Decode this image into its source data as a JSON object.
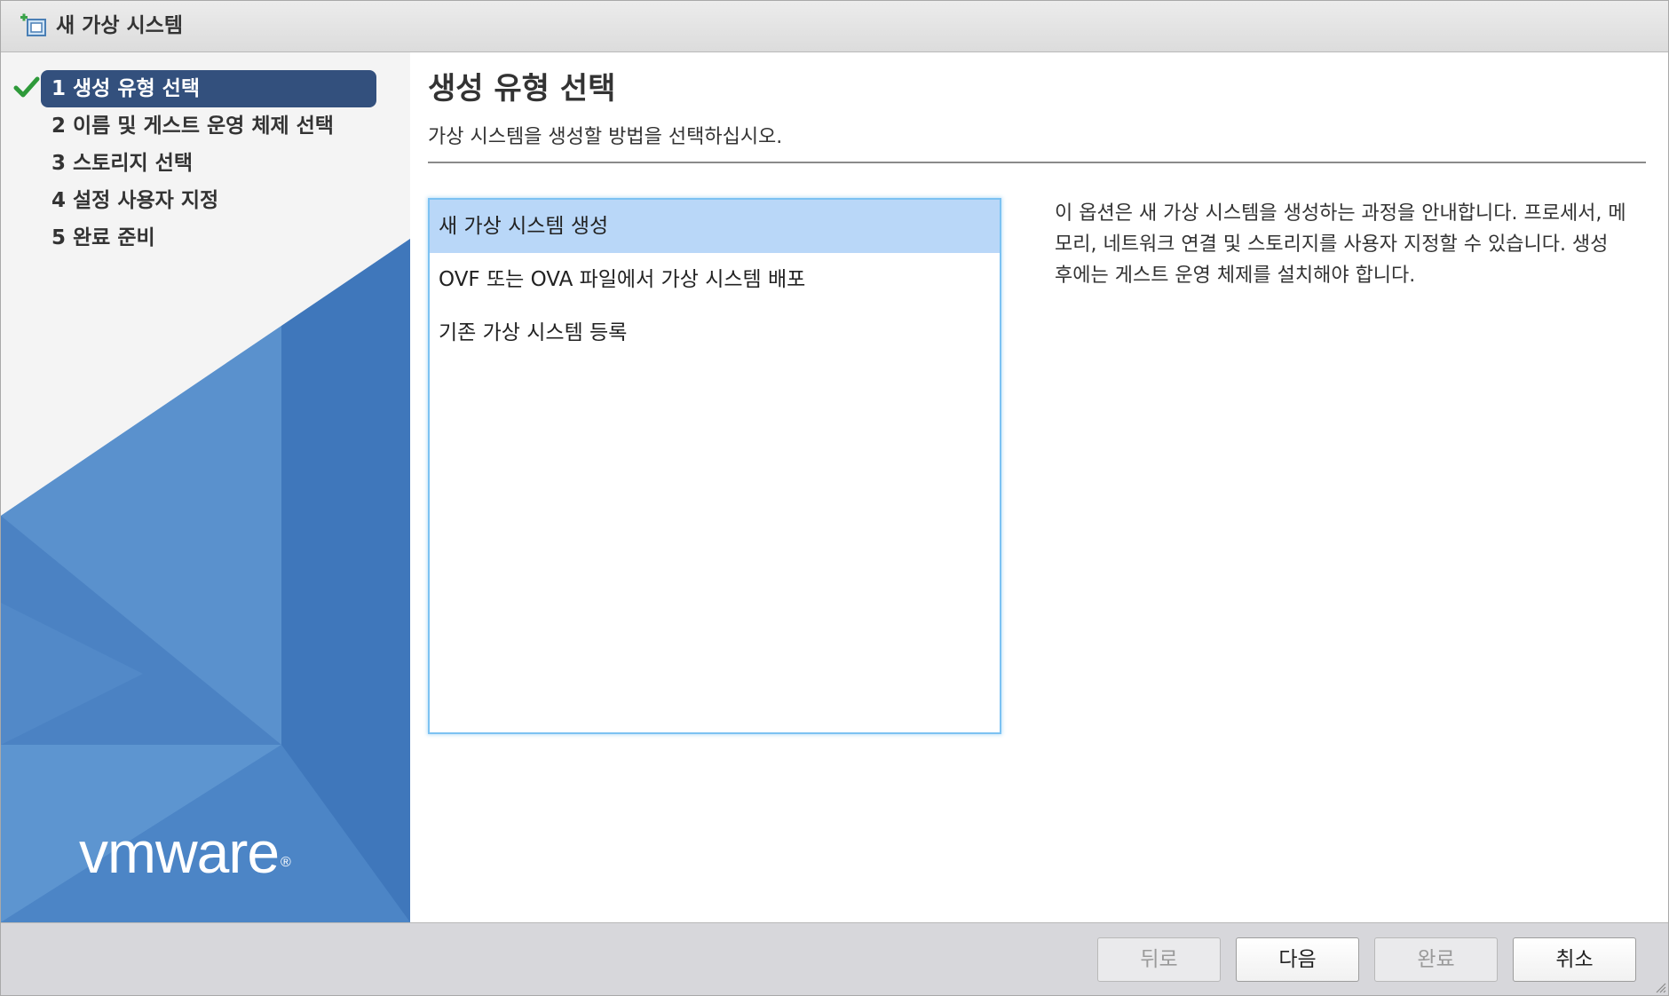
{
  "window": {
    "title": "새 가상 시스템",
    "icon": "new-vm-icon"
  },
  "steps": [
    {
      "label": "1 생성 유형 선택",
      "state": "active",
      "completed": true
    },
    {
      "label": "2 이름 및 게스트 운영 체제 선택",
      "state": "pending"
    },
    {
      "label": "3 스토리지 선택",
      "state": "pending"
    },
    {
      "label": "4 설정 사용자 지정",
      "state": "pending"
    },
    {
      "label": "5 완료 준비",
      "state": "pending"
    }
  ],
  "brand": {
    "logo_text": "vmware",
    "registered_mark": "®"
  },
  "main": {
    "title": "생성 유형 선택",
    "subtitle": "가상 시스템을 생성할 방법을 선택하십시오.",
    "options": [
      {
        "label": "새 가상 시스템 생성",
        "selected": true
      },
      {
        "label": "OVF 또는 OVA 파일에서 가상 시스템 배포",
        "selected": false
      },
      {
        "label": "기존 가상 시스템 등록",
        "selected": false
      }
    ],
    "description": "이 옵션은 새 가상 시스템을 생성하는 과정을 안내합니다. 프로세서, 메모리, 네트워크 연결 및 스토리지를 사용자 지정할 수 있습니다. 생성 후에는 게스트 운영 체제를 설치해야 합니다."
  },
  "footer": {
    "back_label": "뒤로",
    "next_label": "다음",
    "finish_label": "완료",
    "cancel_label": "취소",
    "back_enabled": false,
    "next_enabled": true,
    "finish_enabled": false,
    "cancel_enabled": true
  },
  "colors": {
    "active_step": "#33507d",
    "selected_option": "#b9d7f8",
    "list_border": "#7cc2f2",
    "check_green": "#2e9a3a",
    "brand_blue": "#4a7fc1"
  }
}
